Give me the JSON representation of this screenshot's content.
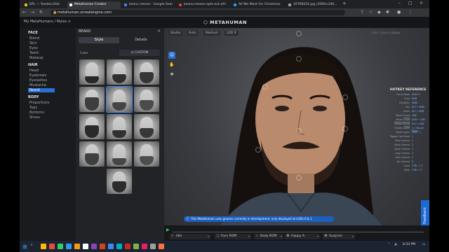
{
  "browser": {
    "tabs": [
      {
        "label": "DFL — Yandex.Disk",
        "color": "#f3c200"
      },
      {
        "label": "MetaHuman Creator",
        "color": "#ffffff",
        "active": true
      },
      {
        "label": "keanu reeves - Google Sear",
        "color": "#4285f4"
      },
      {
        "label": "keanu-reeves-opts-out-of-t",
        "color": "#e53935"
      },
      {
        "label": "All We Want For Christmas",
        "color": "#2a9df4"
      },
      {
        "label": "10768254.jpg (2000×240...",
        "color": "#9e9e9e"
      }
    ],
    "url": "metahuman.unrealengine.com"
  },
  "app": {
    "breadcrumb": "My MetaHumans / Myles ×",
    "brand": "METAHUMAN"
  },
  "sidebar": {
    "groups": [
      {
        "label": "FACE",
        "items": [
          "Blend",
          "Skin",
          "Eyes",
          "Teeth",
          "Makeup"
        ]
      },
      {
        "label": "HAIR",
        "items": [
          "Head",
          "Eyebrows",
          "Eyelashes",
          "Mustache",
          "Beard"
        ]
      },
      {
        "label": "BODY",
        "items": [
          "Proportions",
          "Tops",
          "Bottoms",
          "Shoes"
        ]
      }
    ],
    "selected": "Beard"
  },
  "panel": {
    "title": "BEARD",
    "tabs": [
      "Style",
      "Details"
    ],
    "active_tab": "Style",
    "color_label": "Color",
    "custom_label": "CUSTOM",
    "grid_selected_index": 4
  },
  "viewport": {
    "view_tabs": [
      "Studio",
      "Auto",
      "Medium",
      "LOD 0"
    ],
    "top_right": "LOD 1 (1010 | 9.6Gb/s)",
    "hotkey": {
      "title": "HOTKEY REFERENCE",
      "rows": [
        [
          "Focus Head",
          "Shift+1"
        ],
        [
          "Orbit",
          "RMB"
        ],
        [
          "Pan/Dolly",
          "MMB"
        ],
        [
          "Pan",
          "ALT + MMB"
        ],
        [
          "Zoom",
          "ALT + RMB"
        ],
        [
          "Move Sculpt Point",
          "LMB"
        ],
        [
          "Move Sculpt Point Forward",
          "Shift + LMB"
        ],
        [
          "Rotate Sculpt Point",
          "Ctrl + LMB"
        ],
        [
          "Rotate Lights",
          "L + Mouse Move"
        ],
        [
          "Reset Lights",
          "Shift + L"
        ],
        [
          "Toggle Clay Mode",
          "C"
        ],
        [
          "Face Camera",
          "1"
        ],
        [
          "Body Camera",
          "2"
        ],
        [
          "Torso Camera",
          "3"
        ],
        [
          "Legs Camera",
          "4"
        ],
        [
          "Feet Camera",
          "5"
        ],
        [
          "Far Camera",
          "6"
        ],
        [
          "Undo",
          "CTRL + Z"
        ],
        [
          "Redo",
          "CTRL + Y"
        ]
      ]
    },
    "notice": "This MetaHuman uses grooms currently in development, only displayed at LODs 0 & 1",
    "feedback": "Feedback",
    "timeline_dropdowns": [
      "Idle",
      "Face ROM",
      "Body ROM",
      "Happy A",
      "Surprise"
    ]
  },
  "taskbar": {
    "time": "8:33 PM",
    "apps": [
      "#ffb900",
      "#e74c3c",
      "#2ecc71",
      "#3498db",
      "#f39c12",
      "#ffffff",
      "#8e44ad",
      "#d84315",
      "#4285f4",
      "#00acc1",
      "#c62828",
      "#7cb342",
      "#e91e63",
      "#9e9e9e",
      "#ff7043"
    ]
  }
}
